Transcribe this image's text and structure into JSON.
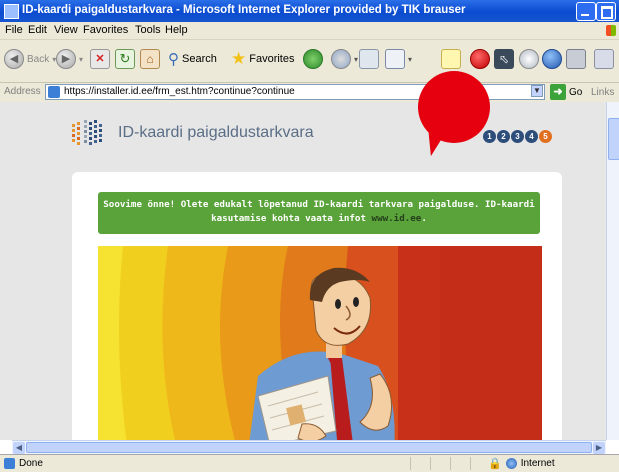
{
  "window": {
    "title": "ID-kaardi paigaldustarkvara - Microsoft Internet Explorer provided by TIK brauser"
  },
  "menu": [
    "File",
    "Edit",
    "View",
    "Favorites",
    "Tools",
    "Help"
  ],
  "toolbar": {
    "back": "Back",
    "search": "Search",
    "favorites": "Favorites"
  },
  "address": {
    "label": "Address",
    "url": "https://installer.id.ee/frm_est.htm?continue?continue",
    "go": "Go",
    "links": "Links"
  },
  "page": {
    "brand": "ID-kaardi paigaldustarkvara",
    "steps": [
      "1",
      "2",
      "3",
      "4",
      "5"
    ],
    "message": "Soovime õnne! Olete edukalt lõpetanud ID-kaardi tarkvara paigalduse. ID-kaardi kasutamise kohta vaata infot ",
    "link": "www.id.ee",
    "message_end": "."
  },
  "status": {
    "text": "Done",
    "zone": "Internet"
  },
  "colors": {
    "accent_green": "#5aa33a",
    "bubble_red": "#e6000f",
    "title_blue": "#0a4bd0"
  }
}
